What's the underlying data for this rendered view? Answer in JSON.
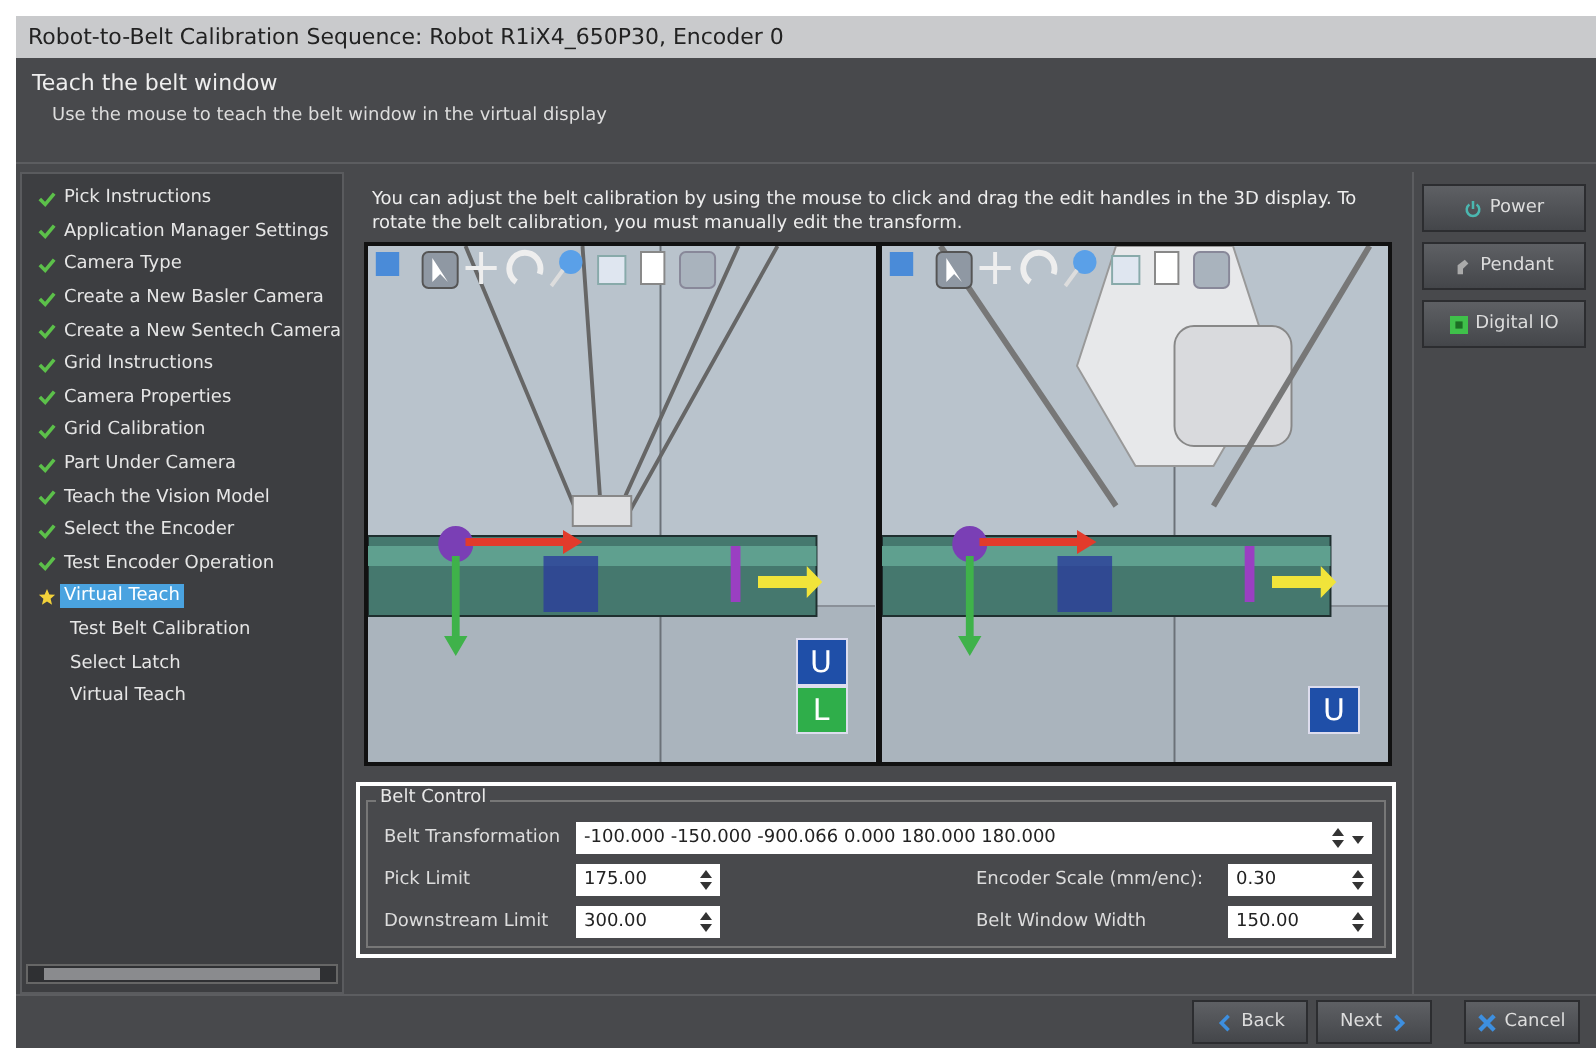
{
  "window": {
    "title": "Robot-to-Belt Calibration Sequence: Robot R1iX4_650P30, Encoder 0"
  },
  "header": {
    "title": "Teach the belt window",
    "subtitle": "Use the mouse to teach the belt window in the virtual display"
  },
  "steps": [
    {
      "label": "Pick Instructions",
      "checked": true,
      "selected": false
    },
    {
      "label": "Application Manager Settings",
      "checked": true,
      "selected": false
    },
    {
      "label": "Camera Type",
      "checked": true,
      "selected": false
    },
    {
      "label": "Create a New Basler Camera",
      "checked": true,
      "selected": false
    },
    {
      "label": "Create a New Sentech Camera",
      "checked": true,
      "selected": false
    },
    {
      "label": "Grid Instructions",
      "checked": true,
      "selected": false
    },
    {
      "label": "Camera Properties",
      "checked": true,
      "selected": false
    },
    {
      "label": "Grid Calibration",
      "checked": true,
      "selected": false
    },
    {
      "label": "Part Under Camera",
      "checked": true,
      "selected": false
    },
    {
      "label": "Teach the Vision Model",
      "checked": true,
      "selected": false
    },
    {
      "label": "Select the Encoder",
      "checked": true,
      "selected": false
    },
    {
      "label": "Test Encoder Operation",
      "checked": true,
      "selected": false
    },
    {
      "label": "Virtual Teach",
      "checked": false,
      "selected": true
    },
    {
      "label": "Test Belt Calibration",
      "checked": false,
      "selected": false
    },
    {
      "label": "Select Latch",
      "checked": false,
      "selected": false
    },
    {
      "label": "Virtual Teach",
      "checked": false,
      "selected": false
    }
  ],
  "instructions": "You can adjust the belt calibration by using the mouse to click and drag the edit handles in the 3D display. To rotate the belt calibration, you must manually edit the transform.",
  "views": [
    {
      "badges": [
        {
          "text": "U",
          "color": "#1f4fa8"
        },
        {
          "text": "L",
          "color": "#2fae4a"
        }
      ]
    },
    {
      "badges": [
        {
          "text": "U",
          "color": "#1f4fa8"
        }
      ]
    }
  ],
  "belt_control": {
    "title": "Belt Control",
    "transformation": {
      "label": "Belt Transformation",
      "value": "-100.000 -150.000 -900.066 0.000 180.000 180.000"
    },
    "left_fields": [
      {
        "label": "Pick Limit",
        "value": "175.00"
      },
      {
        "label": "Downstream Limit",
        "value": "300.00"
      }
    ],
    "right_fields": [
      {
        "label": "Encoder Scale (mm/enc):",
        "value": "0.30"
      },
      {
        "label": "Belt Window Width",
        "value": "150.00"
      }
    ]
  },
  "side_buttons": [
    {
      "label": "Power",
      "kind": "power"
    },
    {
      "label": "Pendant",
      "kind": "pendant"
    },
    {
      "label": "Digital IO",
      "kind": "io"
    }
  ],
  "footer_buttons": [
    {
      "label": "Back",
      "kind": "back"
    },
    {
      "label": "Next",
      "kind": "next"
    },
    {
      "label": "Cancel",
      "kind": "cancel"
    }
  ]
}
